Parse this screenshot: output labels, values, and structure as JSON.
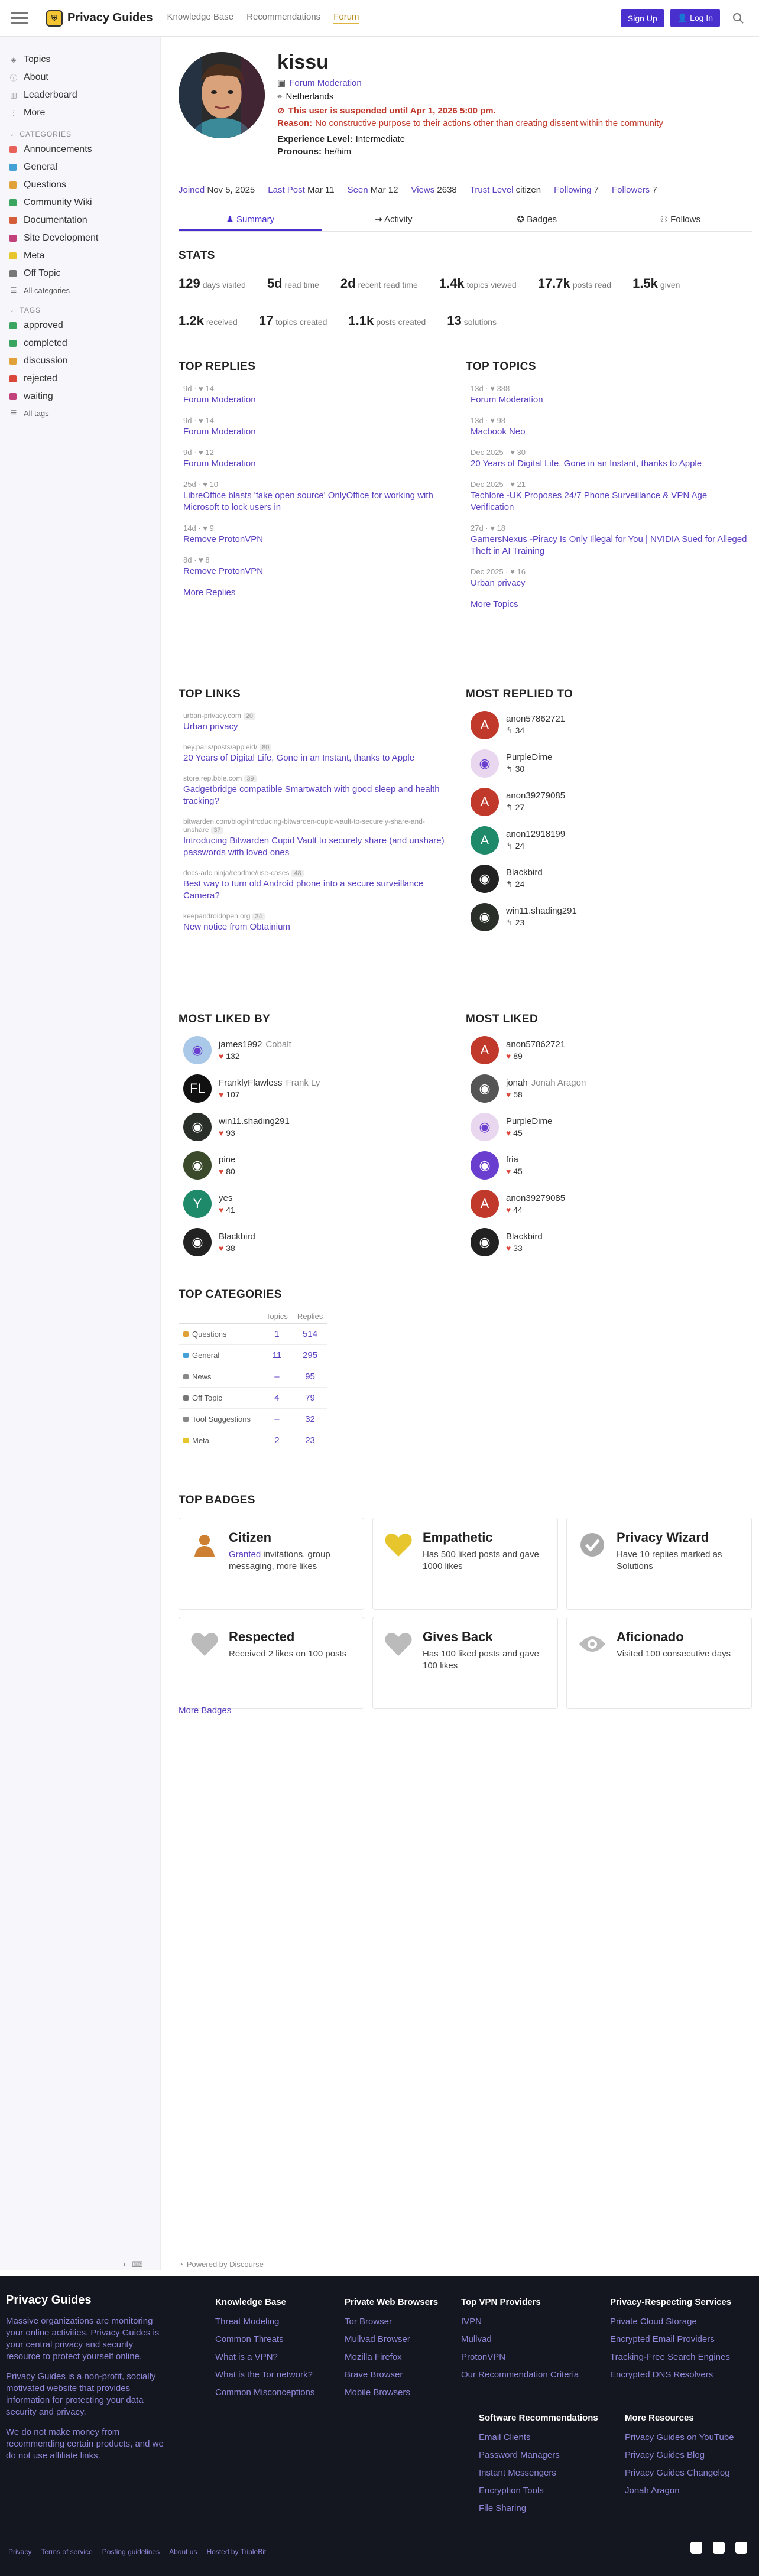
{
  "header": {
    "site_name": "Privacy Guides",
    "nav": [
      "Knowledge Base",
      "Recommendations",
      "Forum"
    ],
    "signup": "Sign Up",
    "login": "Log In"
  },
  "sidebar": {
    "top": [
      {
        "label": "Topics",
        "icon": "layers-icon"
      },
      {
        "label": "About",
        "icon": "info-icon"
      },
      {
        "label": "Leaderboard",
        "icon": "trophy-icon"
      },
      {
        "label": "More",
        "icon": "more-icon"
      }
    ],
    "categories_title": "CATEGORIES",
    "categories": [
      {
        "label": "Announcements",
        "color": "#e8615b"
      },
      {
        "label": "General",
        "color": "#44a1d6"
      },
      {
        "label": "Questions",
        "color": "#e0a03a"
      },
      {
        "label": "Community Wiki",
        "color": "#3aa55f"
      },
      {
        "label": "Documentation",
        "color": "#d45e3a"
      },
      {
        "label": "Site Development",
        "color": "#c2417b"
      },
      {
        "label": "Meta",
        "color": "#e6c52d"
      },
      {
        "label": "Off Topic",
        "color": "#777777"
      }
    ],
    "all_categories": "All categories",
    "tags_title": "TAGS",
    "tags": [
      {
        "label": "approved",
        "color": "#3aa55f"
      },
      {
        "label": "completed",
        "color": "#3aa55f"
      },
      {
        "label": "discussion",
        "color": "#e0a03a"
      },
      {
        "label": "rejected",
        "color": "#d9463a"
      },
      {
        "label": "waiting",
        "color": "#c2417b"
      }
    ],
    "all_tags": "All tags"
  },
  "user": {
    "username": "kissu",
    "group": "Forum Moderation",
    "location": "Netherlands",
    "suspended": "This user is suspended until Apr 1, 2026 5:00 pm.",
    "reason_label": "Reason:",
    "reason": "No constructive purpose to their actions other than creating dissent within the community",
    "experience_label": "Experience Level:",
    "experience": "Intermediate",
    "pronouns_label": "Pronouns:",
    "pronouns": "he/him"
  },
  "summary_line": {
    "joined_label": "Joined",
    "joined": "Nov 5, 2025",
    "last_post_label": "Last Post",
    "last_post": "Mar 11",
    "seen_label": "Seen",
    "seen": "Mar 12",
    "views_label": "Views",
    "views": "2638",
    "trust_label": "Trust Level",
    "trust": "citizen",
    "following_label": "Following",
    "following": "7",
    "followers_label": "Followers",
    "followers": "7"
  },
  "tabs": [
    "Summary",
    "Activity",
    "Badges",
    "Follows"
  ],
  "stats_title": "STATS",
  "stats": [
    {
      "n": "129",
      "l": "days visited"
    },
    {
      "n": "5d",
      "l": "read time"
    },
    {
      "n": "2d",
      "l": "recent read time"
    },
    {
      "n": "1.4k",
      "l": "topics viewed"
    },
    {
      "n": "17.7k",
      "l": "posts read"
    },
    {
      "n": "1.5k",
      "l": "given"
    }
  ],
  "stats2": [
    {
      "n": "1.2k",
      "l": "received"
    },
    {
      "n": "17",
      "l": "topics created"
    },
    {
      "n": "1.1k",
      "l": "posts created"
    },
    {
      "n": "13",
      "l": "solutions"
    }
  ],
  "top_replies": {
    "title": "TOP REPLIES",
    "items": [
      {
        "meta": "9d · ♥ 14",
        "title": "Forum Moderation"
      },
      {
        "meta": "9d · ♥ 14",
        "title": "Forum Moderation"
      },
      {
        "meta": "9d · ♥ 12",
        "title": "Forum Moderation"
      },
      {
        "meta": "25d · ♥ 10",
        "title": "LibreOffice blasts 'fake open source' OnlyOffice for working with Microsoft to lock users in"
      },
      {
        "meta": "14d · ♥ 9",
        "title": "Remove ProtonVPN"
      },
      {
        "meta": "8d · ♥ 8",
        "title": "Remove ProtonVPN"
      }
    ],
    "more": "More Replies"
  },
  "top_topics": {
    "title": "TOP TOPICS",
    "items": [
      {
        "meta": "13d · ♥ 388",
        "title": "Forum Moderation"
      },
      {
        "meta": "13d · ♥ 98",
        "title": "Macbook Neo"
      },
      {
        "meta": "Dec 2025 · ♥ 30",
        "title": "20 Years of Digital Life, Gone in an Instant, thanks to Apple"
      },
      {
        "meta": "Dec 2025 · ♥ 21",
        "title": "Techlore -UK Proposes 24/7 Phone Surveillance & VPN Age Verification"
      },
      {
        "meta": "27d · ♥ 18",
        "title": "GamersNexus -Piracy Is Only Illegal for You | NVIDIA Sued for Alleged Theft in AI Training"
      },
      {
        "meta": "Dec 2025 · ♥ 16",
        "title": "Urban privacy"
      }
    ],
    "more": "More Topics"
  },
  "top_links": {
    "title": "TOP LINKS",
    "items": [
      {
        "domain": "urban-privacy.com",
        "count": "20",
        "title": "Urban privacy"
      },
      {
        "domain": "hey.paris/posts/appleid/",
        "count": "80",
        "title": "20 Years of Digital Life, Gone in an Instant, thanks to Apple"
      },
      {
        "domain": "store.rep.bble.com",
        "count": "39",
        "title": "Gadgetbridge compatible Smartwatch with good sleep and health tracking?"
      },
      {
        "domain": "bitwarden.com/blog/introducing-bitwarden-cupid-vault-to-securely-share-and-unshare",
        "count": "37",
        "title": "Introducing Bitwarden Cupid Vault to securely share (and unshare) passwords with loved ones"
      },
      {
        "domain": "docs-adc.ninja/readme/use-cases",
        "count": "48",
        "title": "Best way to turn old Android phone into a secure surveillance Camera?"
      },
      {
        "domain": "keepandroidopen.org",
        "count": "34",
        "title": "New notice from Obtainium"
      }
    ]
  },
  "most_replied": {
    "title": "MOST REPLIED TO",
    "items": [
      {
        "name": "anon57862721",
        "full": "",
        "count": "34",
        "letter": "A",
        "color": "#c0392b"
      },
      {
        "name": "PurpleDime",
        "full": "",
        "count": "30",
        "letter": "",
        "color": "#e8d7ee"
      },
      {
        "name": "anon39279085",
        "full": "",
        "count": "27",
        "letter": "A",
        "color": "#c0392b"
      },
      {
        "name": "anon12918199",
        "full": "",
        "count": "24",
        "letter": "A",
        "color": "#1e8a6a"
      },
      {
        "name": "Blackbird",
        "full": "",
        "count": "24",
        "letter": "",
        "color": "#222222"
      },
      {
        "name": "win11.shading291",
        "full": "",
        "count": "23",
        "letter": "",
        "color": "#2a2f2a"
      }
    ]
  },
  "most_liked_by": {
    "title": "MOST LIKED BY",
    "items": [
      {
        "name": "james1992",
        "full": "Cobalt",
        "count": "132",
        "letter": "",
        "color": "#aac8e8"
      },
      {
        "name": "FranklyFlawless",
        "full": "Frank Ly",
        "count": "107",
        "letter": "FL",
        "color": "#111111"
      },
      {
        "name": "win11.shading291",
        "full": "",
        "count": "93",
        "letter": "",
        "color": "#2a2f2a"
      },
      {
        "name": "pine",
        "full": "",
        "count": "80",
        "letter": "",
        "color": "#3a4a2a"
      },
      {
        "name": "yes",
        "full": "",
        "count": "41",
        "letter": "Y",
        "color": "#1e8a6a"
      },
      {
        "name": "Blackbird",
        "full": "",
        "count": "38",
        "letter": "",
        "color": "#222222"
      }
    ]
  },
  "most_liked": {
    "title": "MOST LIKED",
    "items": [
      {
        "name": "anon57862721",
        "full": "",
        "count": "89",
        "letter": "A",
        "color": "#c0392b"
      },
      {
        "name": "jonah",
        "full": "Jonah Aragon",
        "count": "58",
        "letter": "",
        "color": "#555555"
      },
      {
        "name": "PurpleDime",
        "full": "",
        "count": "45",
        "letter": "",
        "color": "#e8d7ee"
      },
      {
        "name": "fria",
        "full": "",
        "count": "45",
        "letter": "",
        "color": "#6a3fcf"
      },
      {
        "name": "anon39279085",
        "full": "",
        "count": "44",
        "letter": "A",
        "color": "#c0392b"
      },
      {
        "name": "Blackbird",
        "full": "",
        "count": "33",
        "letter": "",
        "color": "#222222"
      }
    ]
  },
  "top_categories": {
    "title": "TOP CATEGORIES",
    "headers": [
      "Topics",
      "Replies"
    ],
    "rows": [
      {
        "cat": "Questions",
        "color": "#e0a03a",
        "topics": "1",
        "replies": "514"
      },
      {
        "cat": "General",
        "color": "#44a1d6",
        "topics": "11",
        "replies": "295"
      },
      {
        "cat": "News",
        "color": "#888888",
        "topics": "–",
        "replies": "95"
      },
      {
        "cat": "Off Topic",
        "color": "#777777",
        "topics": "4",
        "replies": "79"
      },
      {
        "cat": "Tool Suggestions",
        "color": "#888888",
        "topics": "–",
        "replies": "32"
      },
      {
        "cat": "Meta",
        "color": "#e6c52d",
        "topics": "2",
        "replies": "23"
      }
    ]
  },
  "top_badges": {
    "title": "TOP BADGES",
    "items": [
      {
        "name": "Citizen",
        "desc_link": "Granted",
        "desc": "invitations, group messaging, more likes",
        "icon": "user-icon",
        "color": "#cd7f32"
      },
      {
        "name": "Empathetic",
        "desc_link": "",
        "desc": "Has 500 liked posts and gave 1000 likes",
        "icon": "heart-icon",
        "color": "#e6c52d"
      },
      {
        "name": "Privacy Wizard",
        "desc_link": "",
        "desc": "Have 10 replies marked as Solutions",
        "icon": "check-icon",
        "color": "#aaaaaa"
      },
      {
        "name": "Respected",
        "desc_link": "",
        "desc": "Received 2 likes on 100 posts",
        "icon": "heart-icon",
        "color": "#bbbbbb"
      },
      {
        "name": "Gives Back",
        "desc_link": "",
        "desc": "Has 100 liked posts and gave 100 likes",
        "icon": "heart-icon",
        "color": "#bbbbbb"
      },
      {
        "name": "Aficionado",
        "desc_link": "",
        "desc": "Visited 100 consecutive days",
        "icon": "eye-icon",
        "color": "#bbbbbb"
      }
    ],
    "more": "More Badges"
  },
  "powered": "Powered by Discourse",
  "footer": {
    "title": "Privacy Guides",
    "desc1": "Massive organizations are monitoring your online activities. Privacy Guides is your central privacy and security resource to protect yourself online.",
    "desc2": "Privacy Guides is a non-profit, socially motivated website that provides information for protecting your data security and privacy.",
    "desc3": "We do not make money from recommending certain products, and we do not use affiliate links.",
    "cols": [
      {
        "h": "Knowledge Base",
        "links": [
          "Threat Modeling",
          "Common Threats",
          "What is a VPN?",
          "What is the Tor network?",
          "Common Misconceptions"
        ]
      },
      {
        "h": "Private Web Browsers",
        "links": [
          "Tor Browser",
          "Mullvad Browser",
          "Mozilla Firefox",
          "Brave Browser",
          "Mobile Browsers"
        ]
      },
      {
        "h": "Top VPN Providers",
        "links": [
          "IVPN",
          "Mullvad",
          "ProtonVPN",
          "Our Recommendation Criteria"
        ]
      },
      {
        "h": "Privacy-Respecting Services",
        "links": [
          "Private Cloud Storage",
          "Encrypted Email Providers",
          "Tracking-Free Search Engines",
          "Encrypted DNS Resolvers"
        ]
      },
      {
        "h": "Software Recommendations",
        "links": [
          "Email Clients",
          "Password Managers",
          "Instant Messengers",
          "Encryption Tools",
          "File Sharing"
        ]
      },
      {
        "h": "More Resources",
        "links": [
          "Privacy Guides on YouTube",
          "Privacy Guides Blog",
          "Privacy Guides Changelog",
          "Jonah Aragon"
        ]
      }
    ],
    "bottom": [
      "Privacy",
      "Terms of service",
      "Posting guidelines",
      "About us",
      "Hosted by TripleBit"
    ]
  }
}
